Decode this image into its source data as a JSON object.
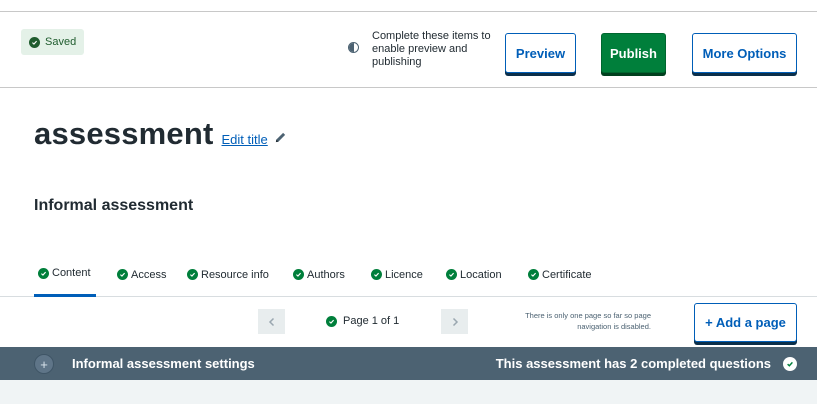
{
  "status": {
    "saved_label": "Saved"
  },
  "toolbar": {
    "hint_text": "Complete these items to enable preview and publishing",
    "preview_label": "Preview",
    "publish_label": "Publish",
    "more_options_label": "More Options"
  },
  "header": {
    "title": "assessment",
    "edit_title_label": "Edit title",
    "subtitle": "Informal assessment"
  },
  "tabs": [
    {
      "label": "Content",
      "complete": true,
      "active": true
    },
    {
      "label": "Access",
      "complete": true,
      "active": false
    },
    {
      "label": "Resource info",
      "complete": true,
      "active": false
    },
    {
      "label": "Authors",
      "complete": true,
      "active": false
    },
    {
      "label": "Licence",
      "complete": true,
      "active": false
    },
    {
      "label": "Location",
      "complete": true,
      "active": false
    },
    {
      "label": "Certificate",
      "complete": true,
      "active": false
    }
  ],
  "pager": {
    "status": "Page 1 of 1",
    "note": "There is only one page so far so page navigation is disabled.",
    "add_page_label": "+ Add a page"
  },
  "settings": {
    "label": "Informal assessment settings",
    "status": "This assessment has 2 completed questions"
  },
  "icons": {
    "saved": "check-circle-icon",
    "hint": "half-circle-icon",
    "edit": "pencil-icon",
    "tab_complete": "check-circle-icon",
    "prev": "chevron-left-icon",
    "next": "chevron-right-icon",
    "expand": "plus-circle-icon",
    "settings_complete": "check-circle-icon"
  },
  "colors": {
    "primary": "#005eb8",
    "success": "#007f3b",
    "settings_bar": "#4c6272",
    "text": "#212b32"
  }
}
